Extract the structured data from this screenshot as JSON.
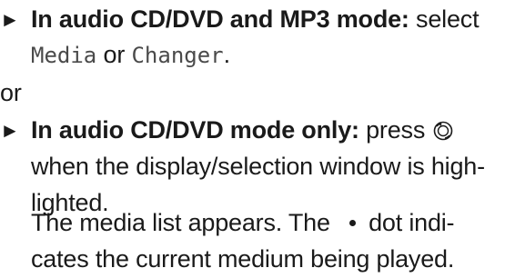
{
  "bullet_1": {
    "arrow": "►",
    "heading": "In audio CD/DVD and MP3 mode:",
    "text_a": " select",
    "option_1": "Media",
    "conj": " or ",
    "option_2": "Changer",
    "end": "."
  },
  "separator": "or",
  "bullet_2": {
    "arrow": "►",
    "heading": "In audio CD/DVD mode only:",
    "text_a": " press ",
    "knob_icon": "rotary-knob-icon",
    "line_2": "when the display/selection window is high-",
    "line_3": "lighted."
  },
  "result": {
    "line_1_a": "The media list appears. The ",
    "line_1_b": "dot indi-",
    "line_2": "cates the current medium being played."
  }
}
